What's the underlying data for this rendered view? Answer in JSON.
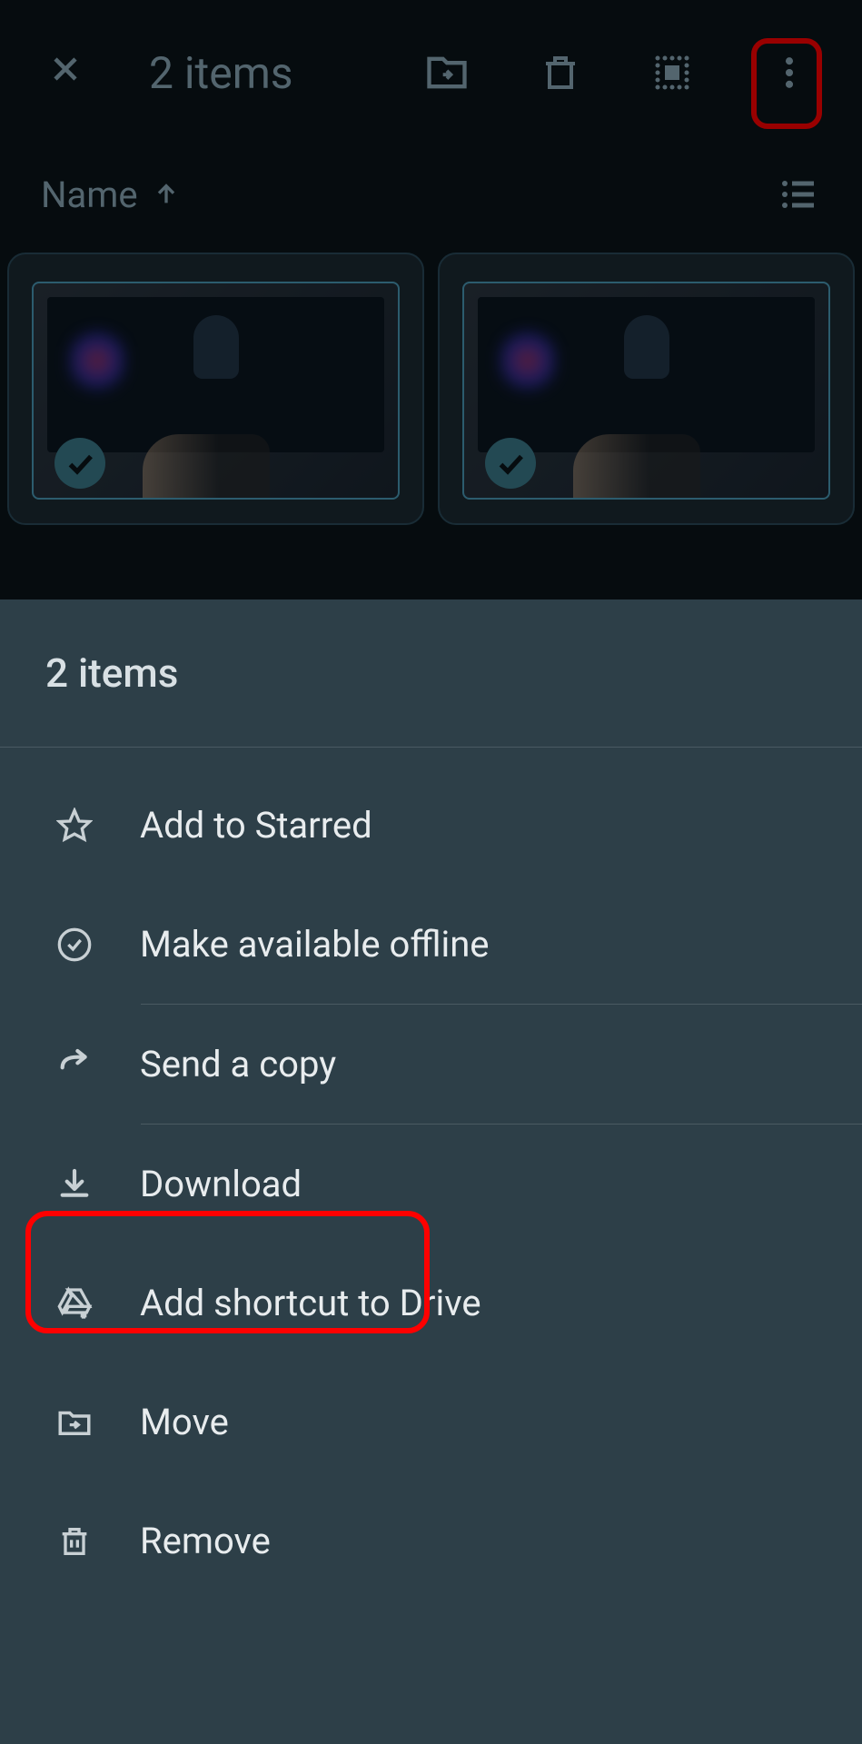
{
  "topBar": {
    "itemCount": "2 items"
  },
  "sortBar": {
    "label": "Name"
  },
  "sheet": {
    "title": "2 items",
    "menu": {
      "starred": "Add to Starred",
      "offline": "Make available offline",
      "sendCopy": "Send a copy",
      "download": "Download",
      "shortcut": "Add shortcut to Drive",
      "move": "Move",
      "remove": "Remove"
    }
  }
}
